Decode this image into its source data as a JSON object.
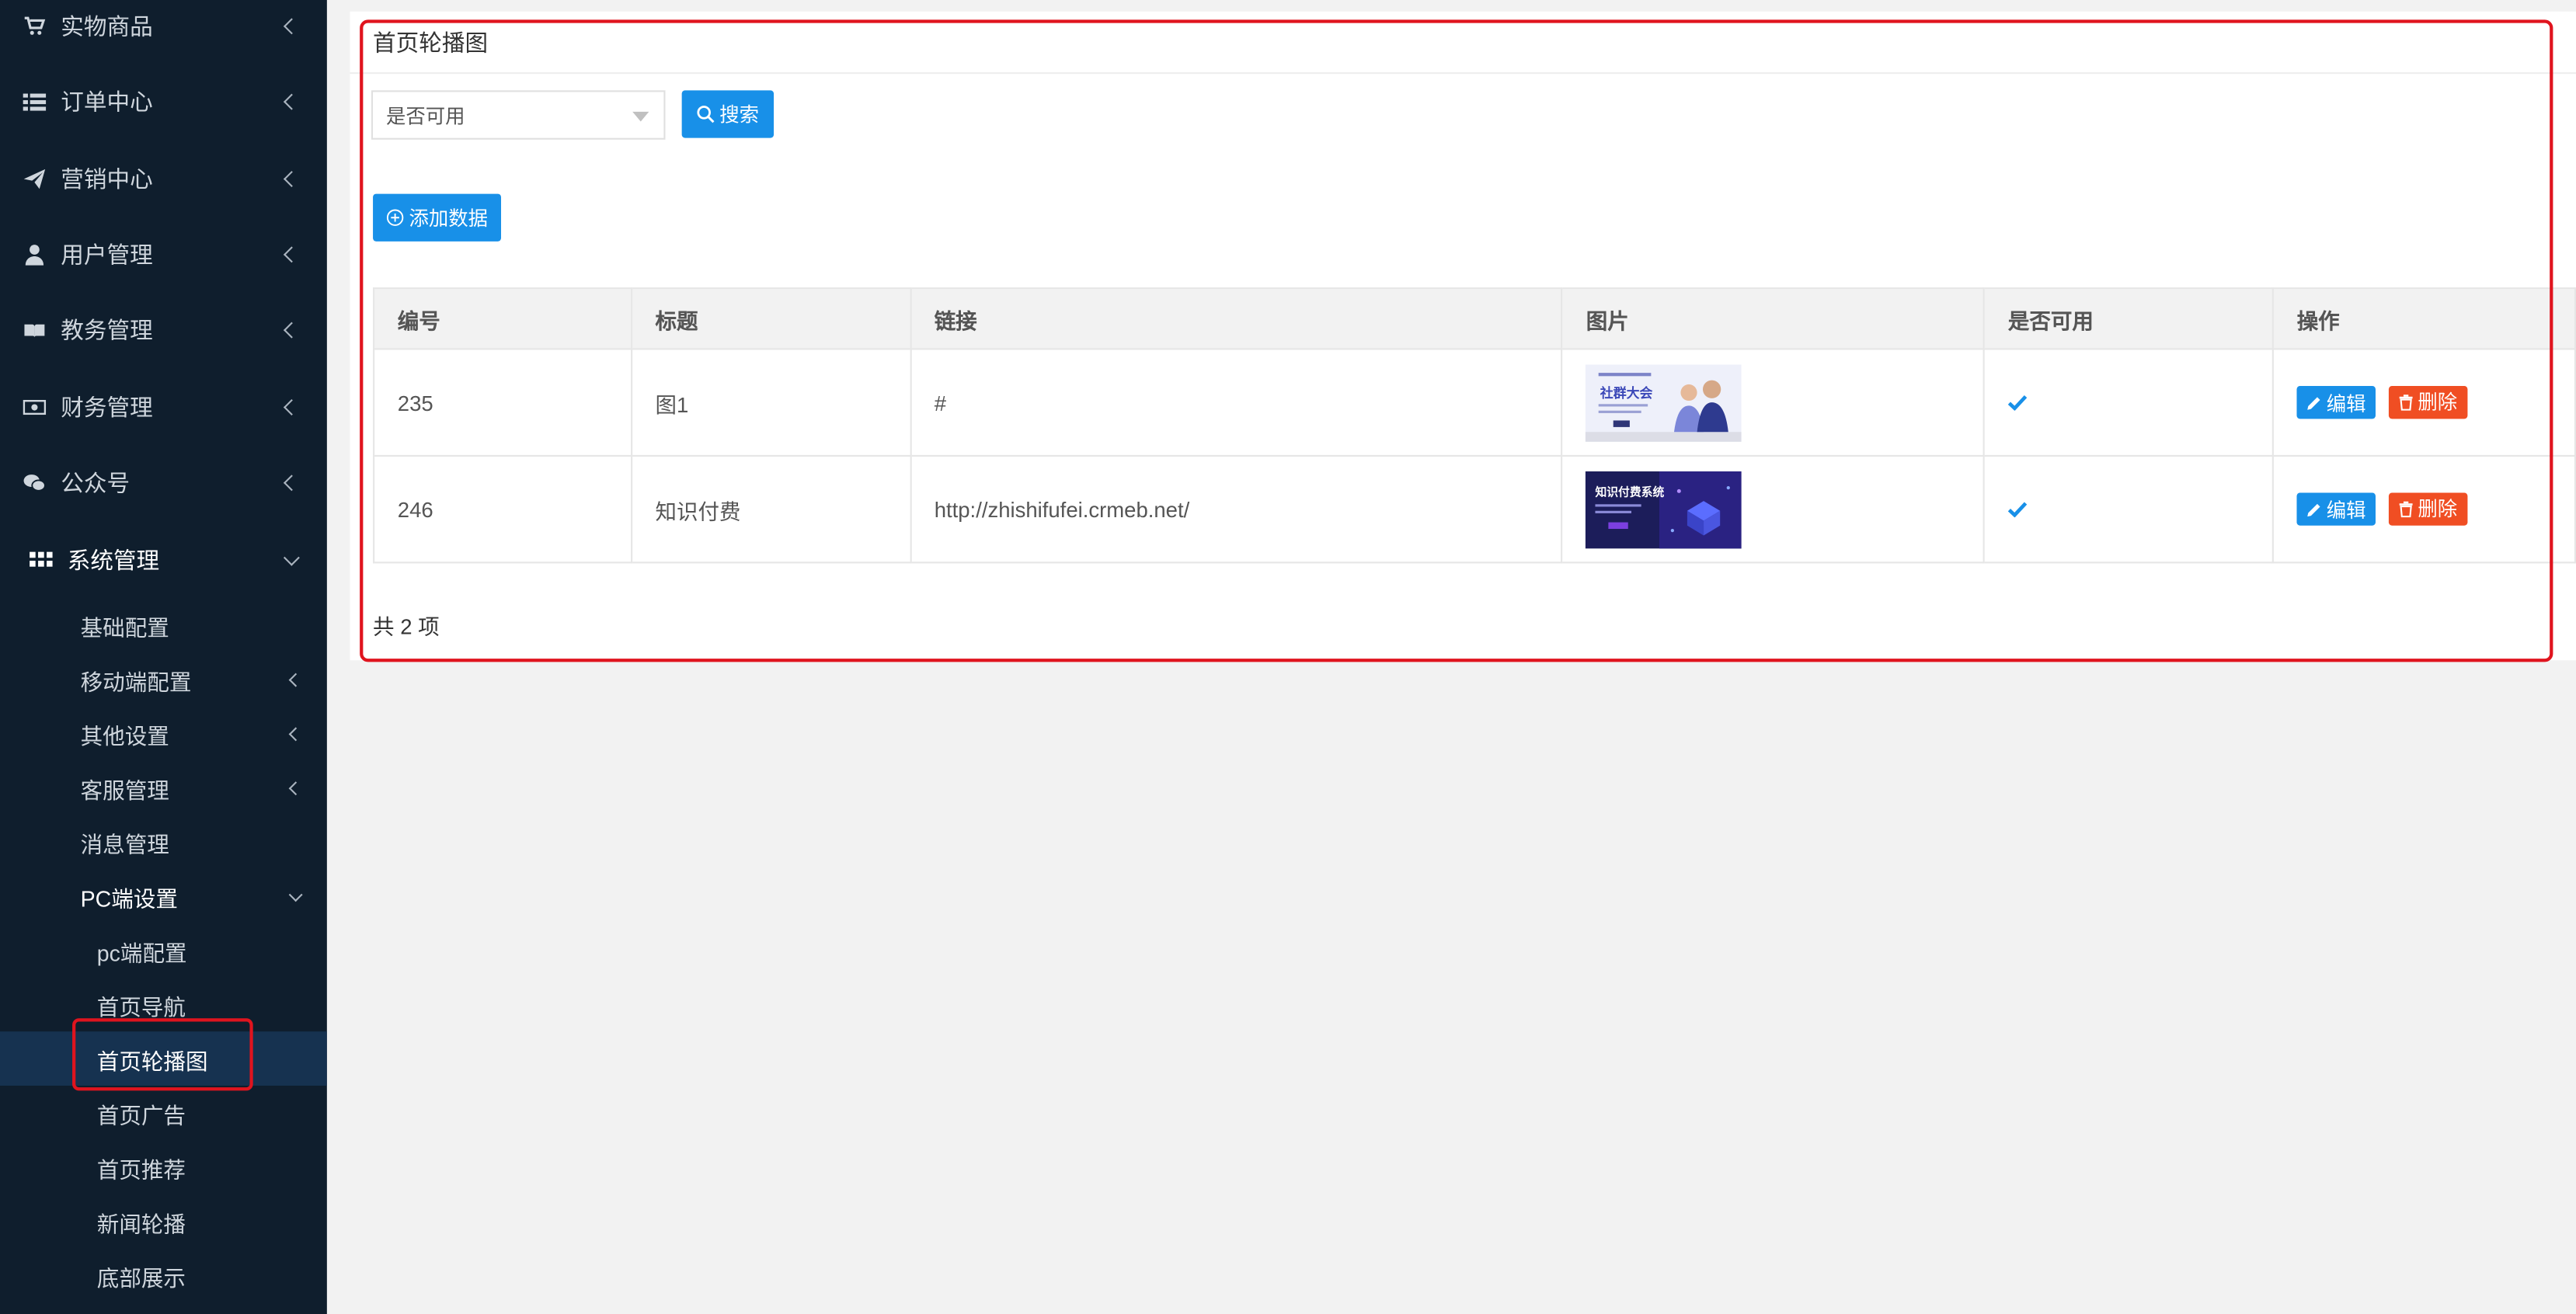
{
  "sidebar": {
    "items": [
      {
        "label": "实物商品",
        "icon": "cart-icon"
      },
      {
        "label": "订单中心",
        "icon": "list-icon"
      },
      {
        "label": "营销中心",
        "icon": "paper-plane-icon"
      },
      {
        "label": "用户管理",
        "icon": "user-icon"
      },
      {
        "label": "教务管理",
        "icon": "book-icon"
      },
      {
        "label": "财务管理",
        "icon": "money-icon"
      },
      {
        "label": "公众号",
        "icon": "wechat-icon"
      },
      {
        "label": "系统管理",
        "icon": "grid-icon"
      }
    ],
    "sub_items": [
      {
        "label": "基础配置"
      },
      {
        "label": "移动端配置"
      },
      {
        "label": "其他设置"
      },
      {
        "label": "客服管理"
      },
      {
        "label": "消息管理"
      },
      {
        "label": "PC端设置"
      }
    ],
    "pc_items": [
      {
        "label": "pc端配置"
      },
      {
        "label": "首页导航"
      },
      {
        "label": "首页轮播图"
      },
      {
        "label": "首页广告"
      },
      {
        "label": "首页推荐"
      },
      {
        "label": "新闻轮播"
      },
      {
        "label": "底部展示"
      }
    ]
  },
  "panel": {
    "title": "首页轮播图"
  },
  "filter": {
    "select_value": "是否可用",
    "search_label": "搜索",
    "add_label": "添加数据"
  },
  "table": {
    "headers": [
      "编号",
      "标题",
      "链接",
      "图片",
      "是否可用",
      "操作"
    ],
    "rows": [
      {
        "id": "235",
        "title": "图1",
        "link": "#",
        "image": "banner-thumbnail-social-conference",
        "available": true
      },
      {
        "id": "246",
        "title": "知识付费",
        "link": "http://zhishifufei.crmeb.net/",
        "image": "banner-thumbnail-knowledge-payment",
        "available": true
      }
    ],
    "edit_label": "编辑",
    "delete_label": "删除"
  },
  "footer": {
    "total": "共 2 项"
  },
  "colors": {
    "sidebar_bg": "#0f1e2d",
    "accent": "#1890e8",
    "danger": "#f04e23",
    "highlight": "#e0141e"
  }
}
